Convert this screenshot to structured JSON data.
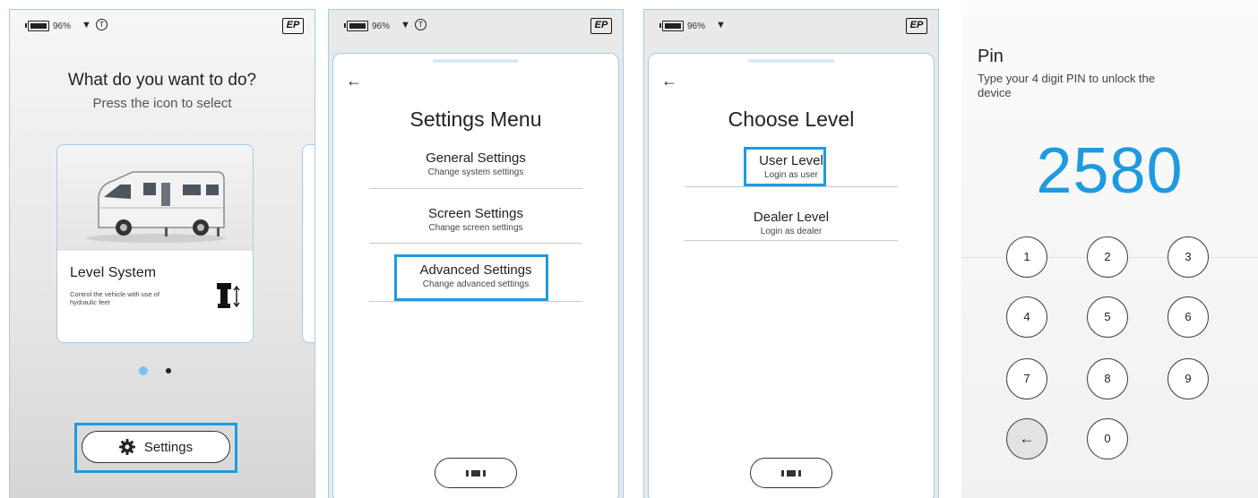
{
  "status_bar": {
    "battery_pct": "96%",
    "logo": "EP"
  },
  "screen1": {
    "title": "What do you want to do?",
    "subtitle": "Press the icon to select",
    "card": {
      "title": "Level System",
      "description": "Control the vehicle with use of hydraulic feet",
      "image_icon": "motorhome-icon",
      "feature_icon": "hydraulic-foot-icon"
    },
    "settings_button": {
      "label": "Settings",
      "icon": "gear-icon"
    }
  },
  "screen2": {
    "title": "Settings Menu",
    "items": [
      {
        "label": "General Settings",
        "sub": "Change system settings"
      },
      {
        "label": "Screen Settings",
        "sub": "Change screen settings"
      },
      {
        "label": "Advanced Settings",
        "sub": "Change advanced settings"
      }
    ]
  },
  "screen3": {
    "title": "Choose Level",
    "items": [
      {
        "label": "User Level",
        "sub": "Login as user"
      },
      {
        "label": "Dealer Level",
        "sub": "Login as dealer"
      }
    ]
  },
  "screen4": {
    "title": "Pin",
    "instruction": "Type your 4 digit PIN to unlock the device",
    "pin": "2580",
    "keys": [
      "1",
      "2",
      "3",
      "4",
      "5",
      "6",
      "7",
      "8",
      "9",
      "←",
      "0"
    ]
  },
  "colors": {
    "accent": "#1e9be0",
    "screen_border": "#9ecfee",
    "dot_active": "#74c4f2"
  }
}
